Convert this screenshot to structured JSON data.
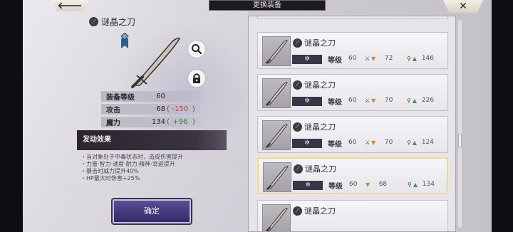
{
  "header": {
    "title": "更换装备",
    "back_label": "🡐",
    "close_label": "✕"
  },
  "detail": {
    "name": "谜晶之刀",
    "stats": [
      {
        "label": "装备等级",
        "value": "60",
        "delta": "",
        "delta_type": ""
      },
      {
        "label": "攻击",
        "value": "68",
        "delta": "-150",
        "delta_type": "neg"
      },
      {
        "label": "魔力",
        "value": "134",
        "delta": "+96",
        "delta_type": "pos"
      }
    ],
    "effect_title": "发动效果",
    "effects": [
      "・当对象处于中毒状态时，造成伤害提升",
      "・力量·智力·速度·耐力·精神·幸运提升",
      "・暴击时威力提升40%",
      "・HP最大时伤害+25%"
    ],
    "confirm_label": "确定"
  },
  "list": {
    "level_label": "等级",
    "star_label": "✲",
    "items": [
      {
        "name": "谜晶之刀",
        "level": "60",
        "stat_a": "72",
        "stat_b": "146",
        "selected": false
      },
      {
        "name": "谜晶之刀",
        "level": "60",
        "stat_a": "70",
        "stat_b": "226",
        "selected": false
      },
      {
        "name": "谜晶之刀",
        "level": "60",
        "stat_a": "70",
        "stat_b": "124",
        "selected": false
      },
      {
        "name": "谜晶之刀",
        "level": "60",
        "stat_a": "68",
        "stat_b": "134",
        "selected": true
      },
      {
        "name": "谜晶之刀",
        "level": "",
        "stat_a": "",
        "stat_b": "",
        "selected": false
      }
    ]
  }
}
